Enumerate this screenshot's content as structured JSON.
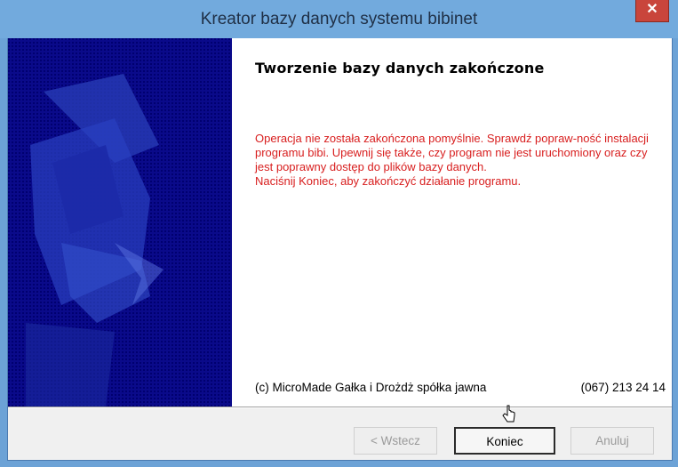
{
  "window": {
    "title": "Kreator bazy danych systemu bibinet",
    "close_label": "✕"
  },
  "content": {
    "heading": "Tworzenie bazy danych zakończone",
    "message_line1": "Operacja nie została zakończona pomyślnie. Sprawdź popraw-ność instalacji programu bibi. Upewnij się także, czy program nie jest uruchomiony oraz czy jest poprawny dostęp do plików bazy danych.",
    "message_line2": "Naciśnij Koniec, aby zakończyć działanie programu.",
    "copyright": "(c) MicroMade Gałka i Drożdż spółka jawna",
    "phone": "(067) 213 24 14"
  },
  "buttons": {
    "back": "< Wstecz",
    "finish": "Koniec",
    "cancel": "Anuluj"
  },
  "colors": {
    "banner": "#0a0a8a",
    "message": "#d81e1e",
    "titlebar": "#72aadd"
  }
}
